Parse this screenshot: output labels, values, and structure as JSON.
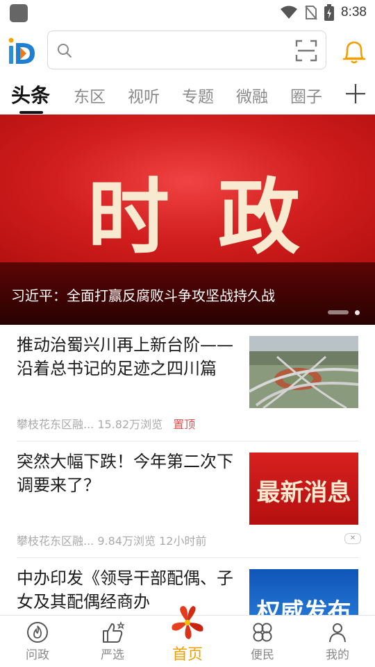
{
  "status": {
    "time": "8:38"
  },
  "search": {
    "placeholder": ""
  },
  "tabs": [
    {
      "label": "头条"
    },
    {
      "label": "东区"
    },
    {
      "label": "视听"
    },
    {
      "label": "专题"
    },
    {
      "label": "微融"
    },
    {
      "label": "圈子"
    }
  ],
  "banner": {
    "char1": "时",
    "char2": "政",
    "caption": "习近平：全面打赢反腐败斗争攻坚战持久战"
  },
  "articles": [
    {
      "title": "推动治蜀兴川再上新台阶——沿着总书记的足迹之四川篇",
      "source": "攀枝花东区融...",
      "views": "15.82万浏览",
      "tag": "置顶"
    },
    {
      "title": "突然大幅下跌！今年第二次下调要来了？",
      "source": "攀枝花东区融...",
      "views": "9.84万浏览",
      "time": "12小时前",
      "thumb_text": "最新消息"
    },
    {
      "title": "中办印发《领导干部配偶、子女及其配偶经商办",
      "thumb_text": "权威发布"
    }
  ],
  "nav": [
    {
      "label": "问政"
    },
    {
      "label": "严选"
    },
    {
      "label": "首页"
    },
    {
      "label": "便民"
    },
    {
      "label": "我的"
    }
  ],
  "colors": {
    "accent": "#f0a000",
    "banner_red": "#d21e1e",
    "pin_red": "#e05050"
  }
}
